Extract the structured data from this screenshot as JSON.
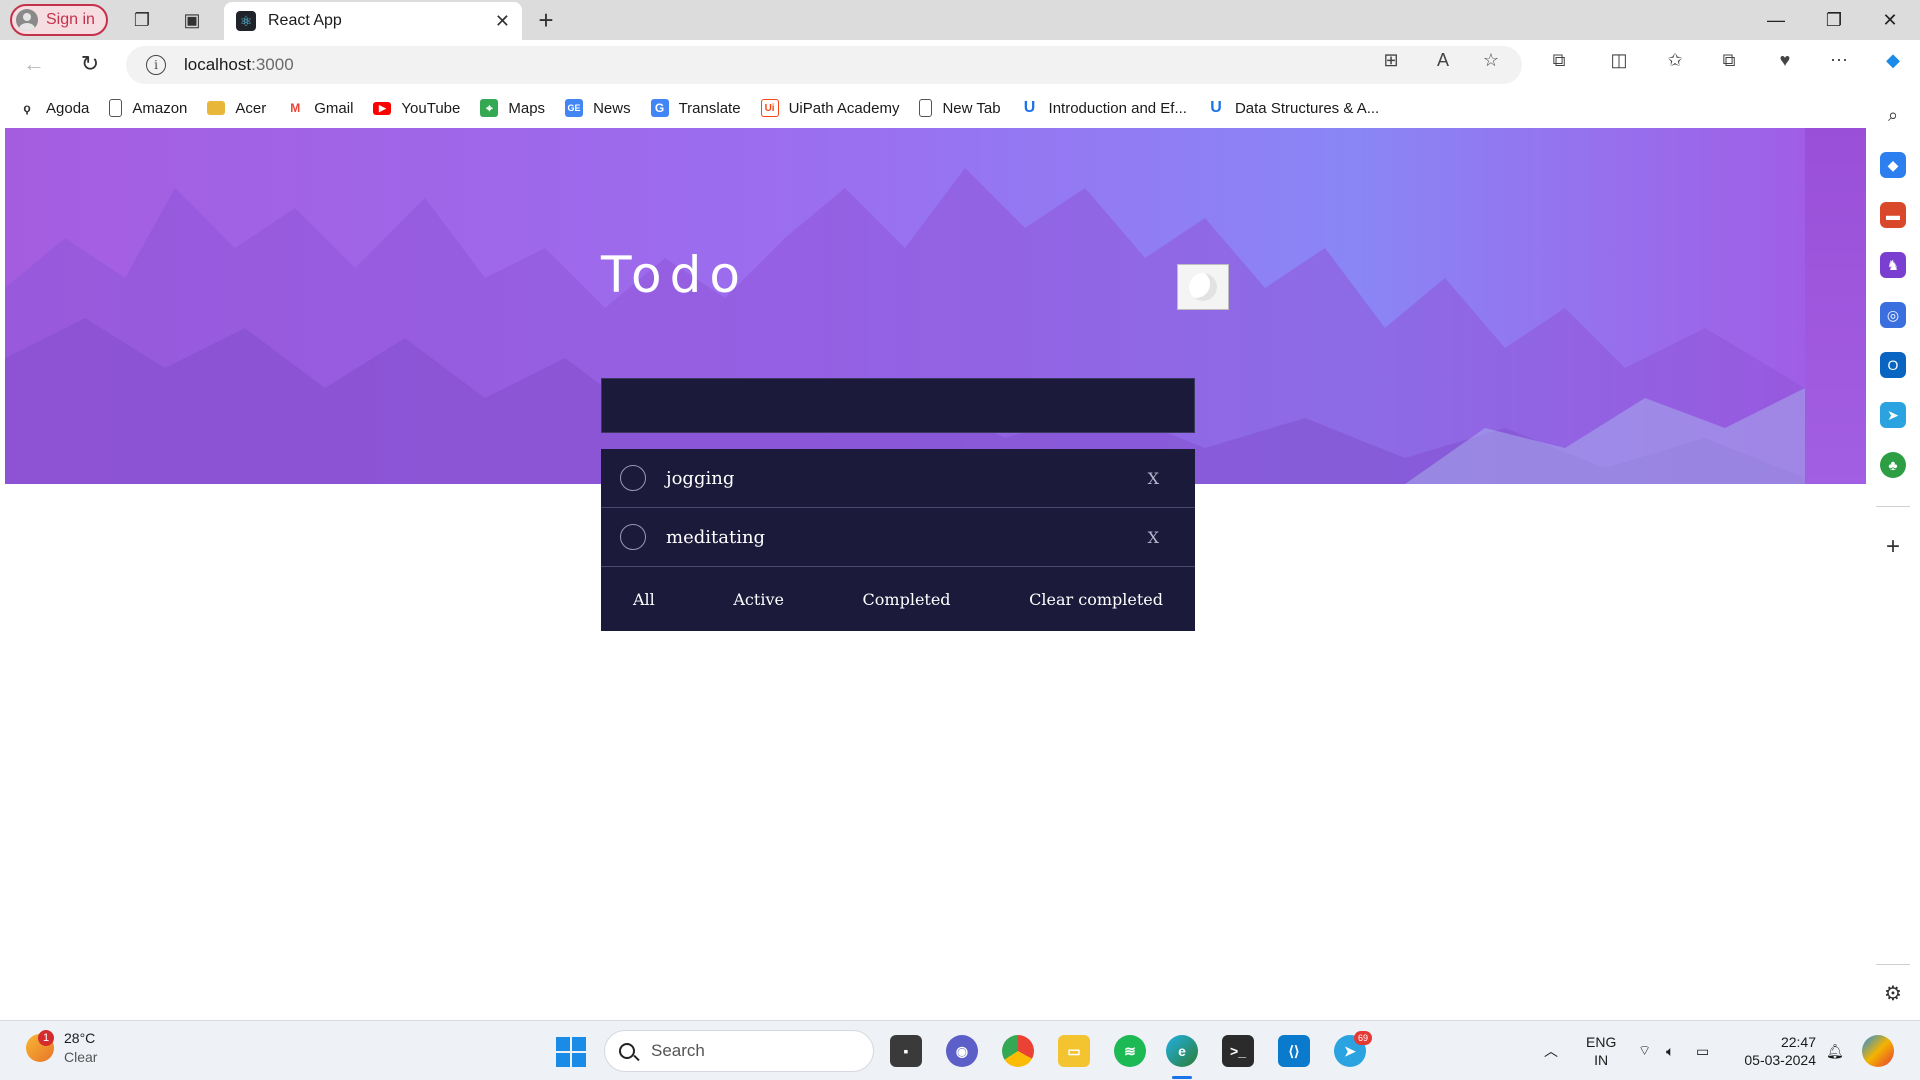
{
  "browser": {
    "signin_label": "Sign in",
    "tab_title": "React App",
    "url_host": "localhost",
    "url_port": ":3000"
  },
  "bookmarks": [
    {
      "label": "Agoda",
      "icon": "agoda-icon",
      "color": "#333333"
    },
    {
      "label": "Amazon",
      "icon": "page-icon",
      "color": "#555555"
    },
    {
      "label": "Acer",
      "icon": "folder-icon",
      "color": "#e8b73a"
    },
    {
      "label": "Gmail",
      "icon": "gmail-icon",
      "color": "#ea4335"
    },
    {
      "label": "YouTube",
      "icon": "youtube-icon",
      "color": "#ff0000"
    },
    {
      "label": "Maps",
      "icon": "maps-icon",
      "color": "#34a853"
    },
    {
      "label": "News",
      "icon": "news-icon",
      "color": "#4285f4"
    },
    {
      "label": "Translate",
      "icon": "translate-icon",
      "color": "#4285f4"
    },
    {
      "label": "UiPath Academy",
      "icon": "uipath-icon",
      "color": "#fa4616"
    },
    {
      "label": "New Tab",
      "icon": "page-icon",
      "color": "#555555"
    },
    {
      "label": "Introduction and Ef...",
      "icon": "udemy-icon",
      "color": "#1a73e8"
    },
    {
      "label": "Data Structures & A...",
      "icon": "udemy-icon",
      "color": "#1a73e8"
    }
  ],
  "app": {
    "title": "Todo",
    "new_todo_value": "",
    "todos": [
      {
        "text": "jogging",
        "completed": false,
        "remove_label": "X"
      },
      {
        "text": "meditating",
        "completed": false,
        "remove_label": "X"
      }
    ],
    "filters": {
      "all": "All",
      "active": "Active",
      "completed": "Completed",
      "clear": "Clear completed"
    }
  },
  "taskbar": {
    "weather_temp": "28°C",
    "weather_cond": "Clear",
    "weather_badge": "1",
    "search_label": "Search",
    "telegram_badge": "69",
    "lang_line1": "ENG",
    "lang_line2": "IN",
    "time": "22:47",
    "date": "05-03-2024"
  }
}
